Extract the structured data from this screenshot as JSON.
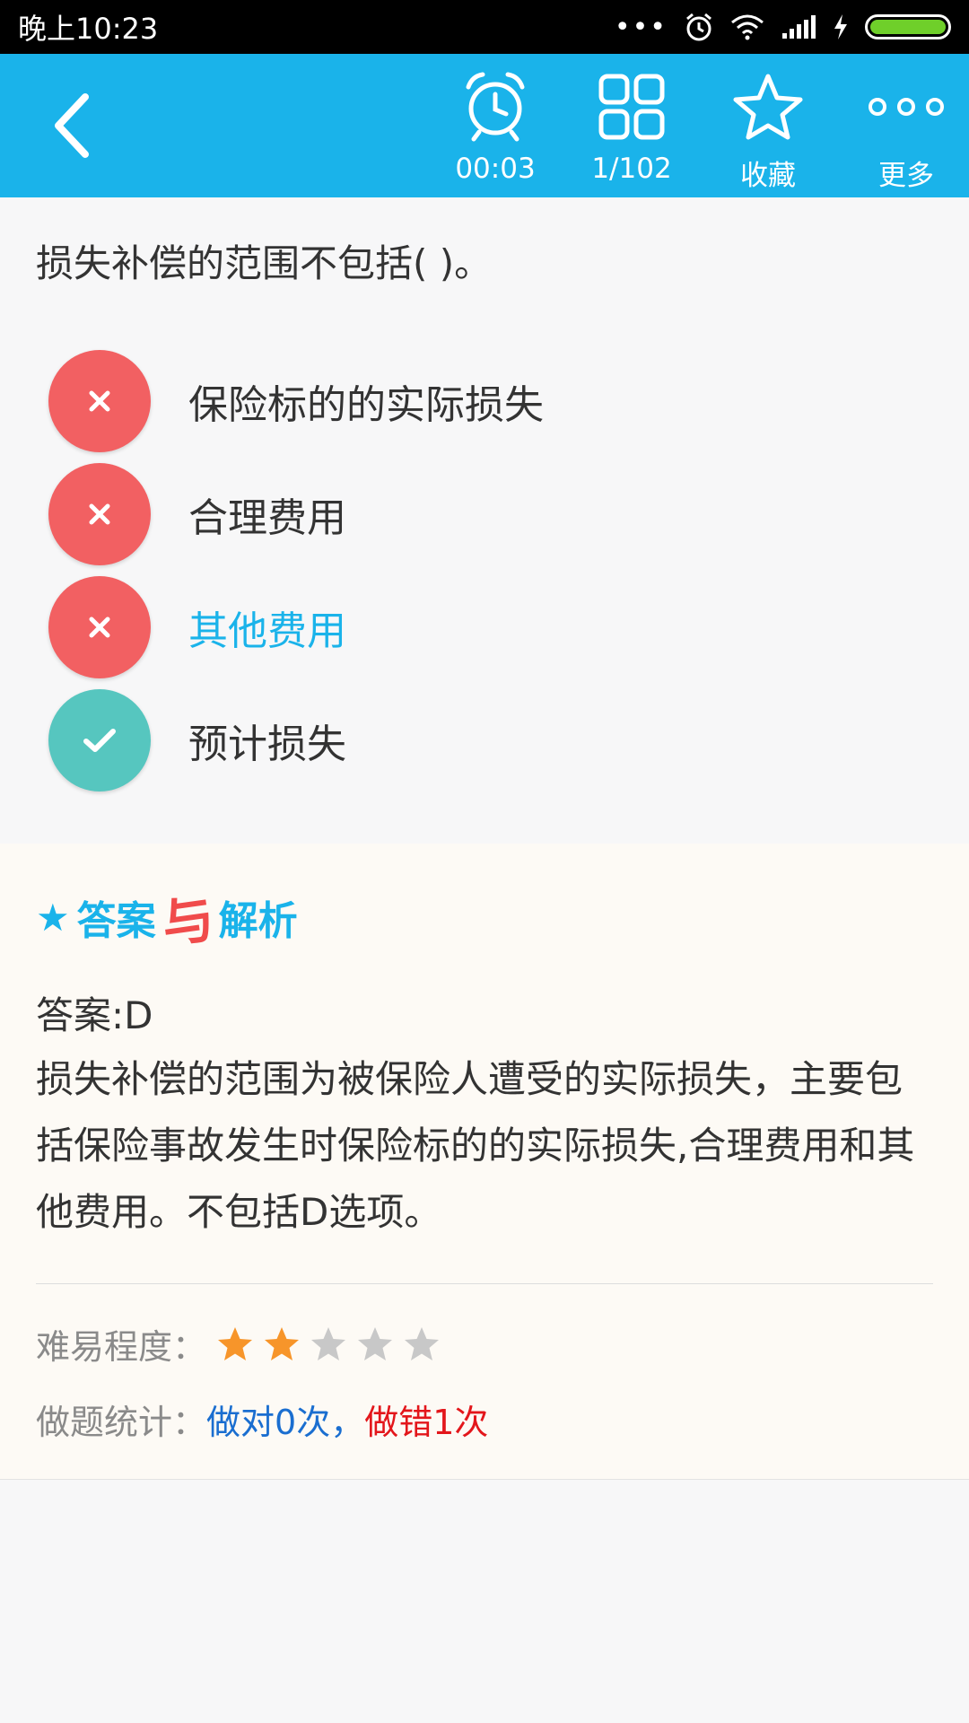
{
  "status_bar": {
    "time": "晚上10:23"
  },
  "toolbar": {
    "timer": "00:03",
    "progress": "1/102",
    "favorite_label": "收藏",
    "more_label": "更多"
  },
  "question": {
    "text": "损失补偿的范围不包括(      )。",
    "options": [
      {
        "text": "保险标的的实际损失",
        "state": "wrong"
      },
      {
        "text": "合理费用",
        "state": "wrong"
      },
      {
        "text": "其他费用",
        "state": "wrong"
      },
      {
        "text": "预计损失",
        "state": "correct"
      }
    ]
  },
  "analysis": {
    "title_left": "答案",
    "title_mid": "与",
    "title_right": "解析",
    "answer": "答案:D",
    "explanation": "损失补偿的范围为被保险人遭受的实际损失，主要包括保险事故发生时保险标的的实际损失,合理费用和其他费用。不包括D选项。",
    "difficulty_label": "难易程度：",
    "difficulty_stars": 2,
    "difficulty_max": 5,
    "stats_label": "做题统计：",
    "stats_right": "做对0次，",
    "stats_wrong": "做错1次"
  },
  "colors": {
    "accent": "#1ab3ea",
    "wrong": "#f26062",
    "correct": "#56c6bf",
    "star_on": "#f7952a",
    "star_off": "#c8c8c8"
  },
  "icons": [
    "back-chevron-icon",
    "alarm-clock-icon",
    "grid-icon",
    "star-icon",
    "more-dots-icon",
    "close-icon",
    "check-icon"
  ]
}
